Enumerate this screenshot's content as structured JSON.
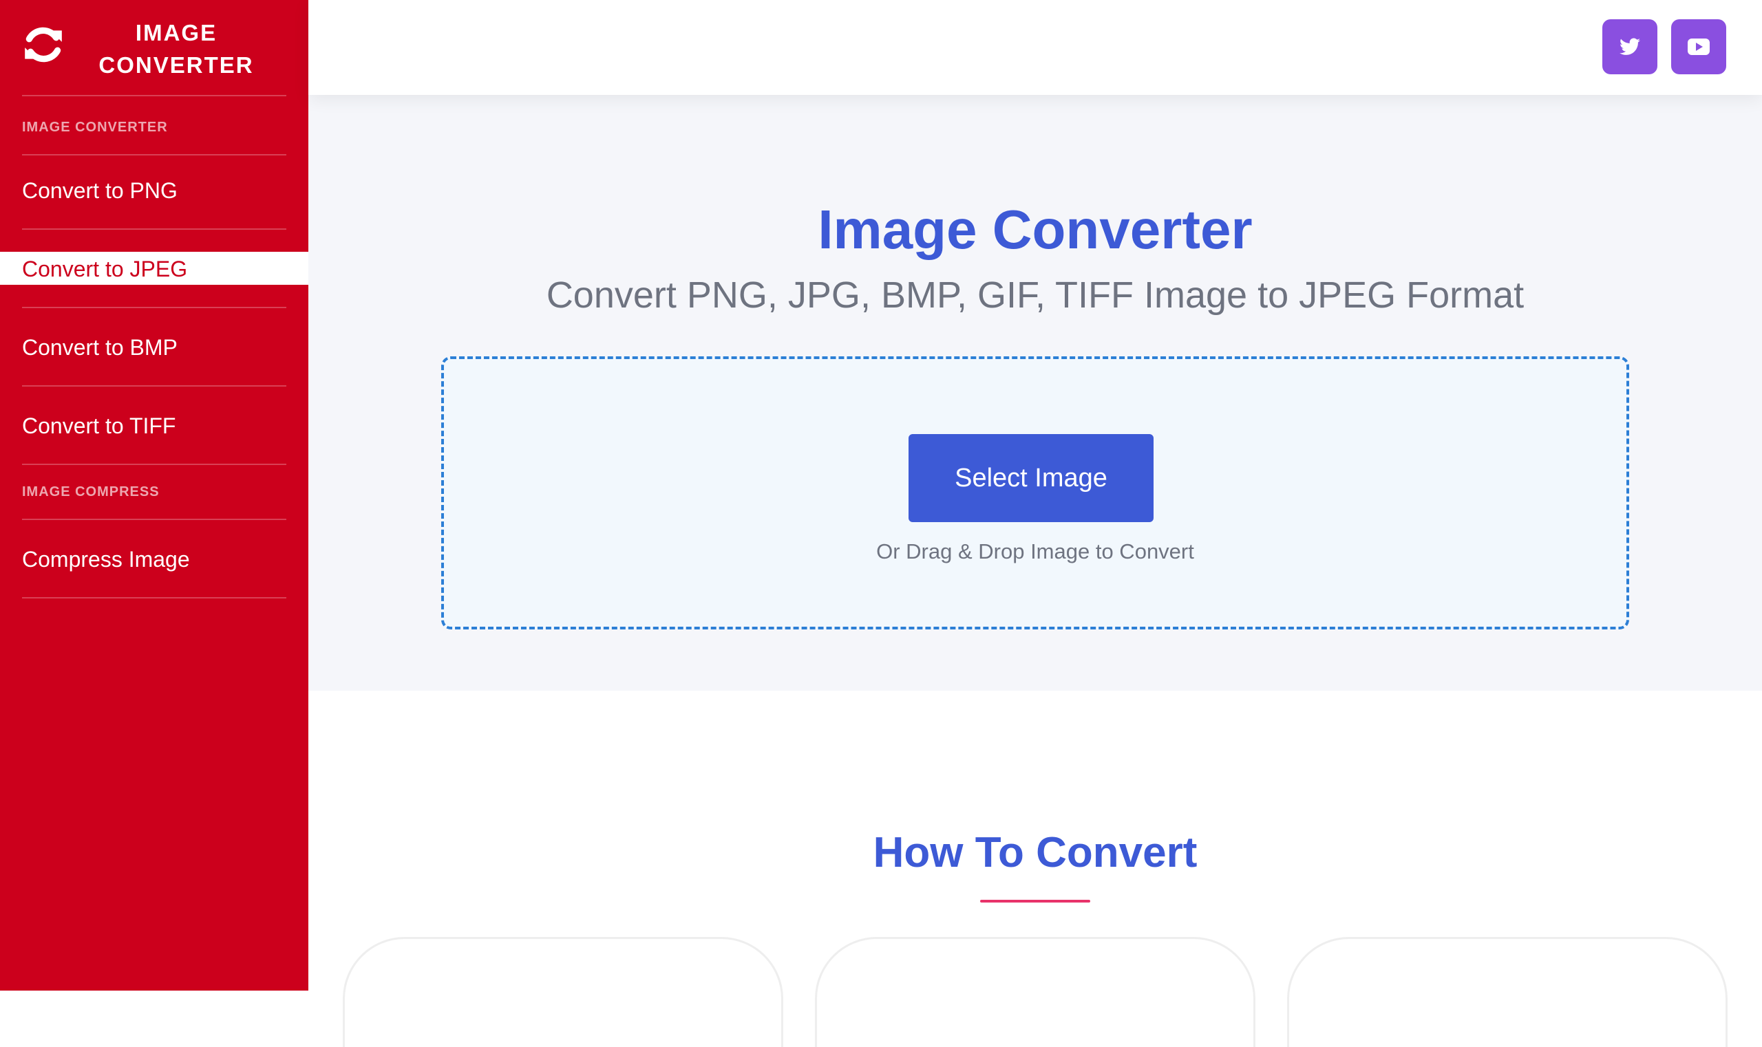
{
  "brand": {
    "line1": "IMAGE",
    "line2": "CONVERTER",
    "icon": "refresh-icon"
  },
  "sidebar": {
    "sections": [
      {
        "header": "IMAGE CONVERTER"
      },
      {
        "header": "IMAGE COMPRESS"
      }
    ],
    "items": [
      {
        "label": "Convert to PNG"
      },
      {
        "label": "Convert to JPEG",
        "active": true
      },
      {
        "label": "Convert to BMP"
      },
      {
        "label": "Convert to TIFF"
      },
      {
        "label": "Compress Image"
      }
    ]
  },
  "header": {
    "social": [
      {
        "icon": "twitter-icon"
      },
      {
        "icon": "youtube-icon"
      }
    ]
  },
  "hero": {
    "title": "Image Converter",
    "subtitle": "Convert PNG, JPG, BMP, GIF, TIFF Image to JPEG Format",
    "select_button": "Select Image",
    "drag_text": "Or Drag & Drop Image to Convert"
  },
  "howto": {
    "title": "How To Convert"
  },
  "colors": {
    "sidebar": "#cc001c",
    "accent": "#3d5ad6",
    "social": "#8a4fe0",
    "underline": "#e8336a",
    "dropzone_border": "#2c7fd6"
  }
}
